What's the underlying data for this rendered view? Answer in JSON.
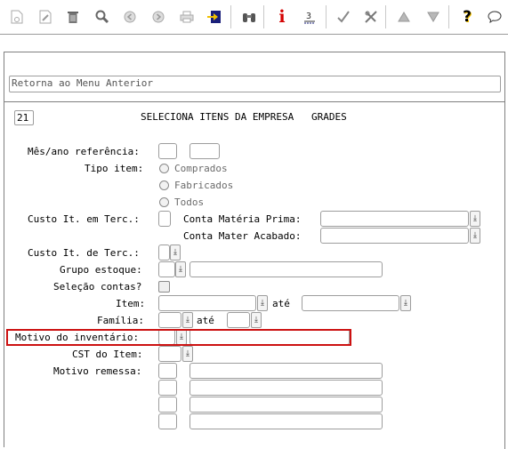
{
  "toolbar": {
    "icons": [
      "new-doc-icon",
      "edit-icon",
      "trash-icon",
      "search-icon",
      "prev-icon",
      "next-icon",
      "print-icon",
      "export-icon",
      "binoculars-icon",
      "info-icon",
      "report-icon",
      "check-icon",
      "tools-icon",
      "up-icon",
      "down-icon",
      "help-icon",
      "chat-icon"
    ]
  },
  "menu": {
    "back_label": "Retorna ao Menu Anterior"
  },
  "header": {
    "code": "21",
    "title": "SELECIONA ITENS DA EMPRESA   GRADES"
  },
  "form": {
    "mes_ano_label": "Mês/ano referência:",
    "tipo_item_label": "Tipo item:",
    "tipo_options": [
      "Comprados",
      "Fabricados",
      "Todos"
    ],
    "custo_terc_label": "Custo It. em Terc.:",
    "conta_mp_label": "Conta Matéria Prima:",
    "conta_ma_label": "Conta Mater Acabado:",
    "custo_de_terc_label": "Custo It. de Terc.:",
    "grupo_estoque_label": "Grupo estoque:",
    "selecao_contas_label": "Seleção contas?",
    "item_label": "Item:",
    "ate_label": "até",
    "familia_label": "Família:",
    "motivo_inventario_label": "Motivo do inventário:",
    "cst_label": "CST do Item:",
    "motivo_remessa_label": "Motivo remessa:"
  },
  "colors": {
    "highlight": "#cc1111",
    "border": "#9d9d9d"
  }
}
